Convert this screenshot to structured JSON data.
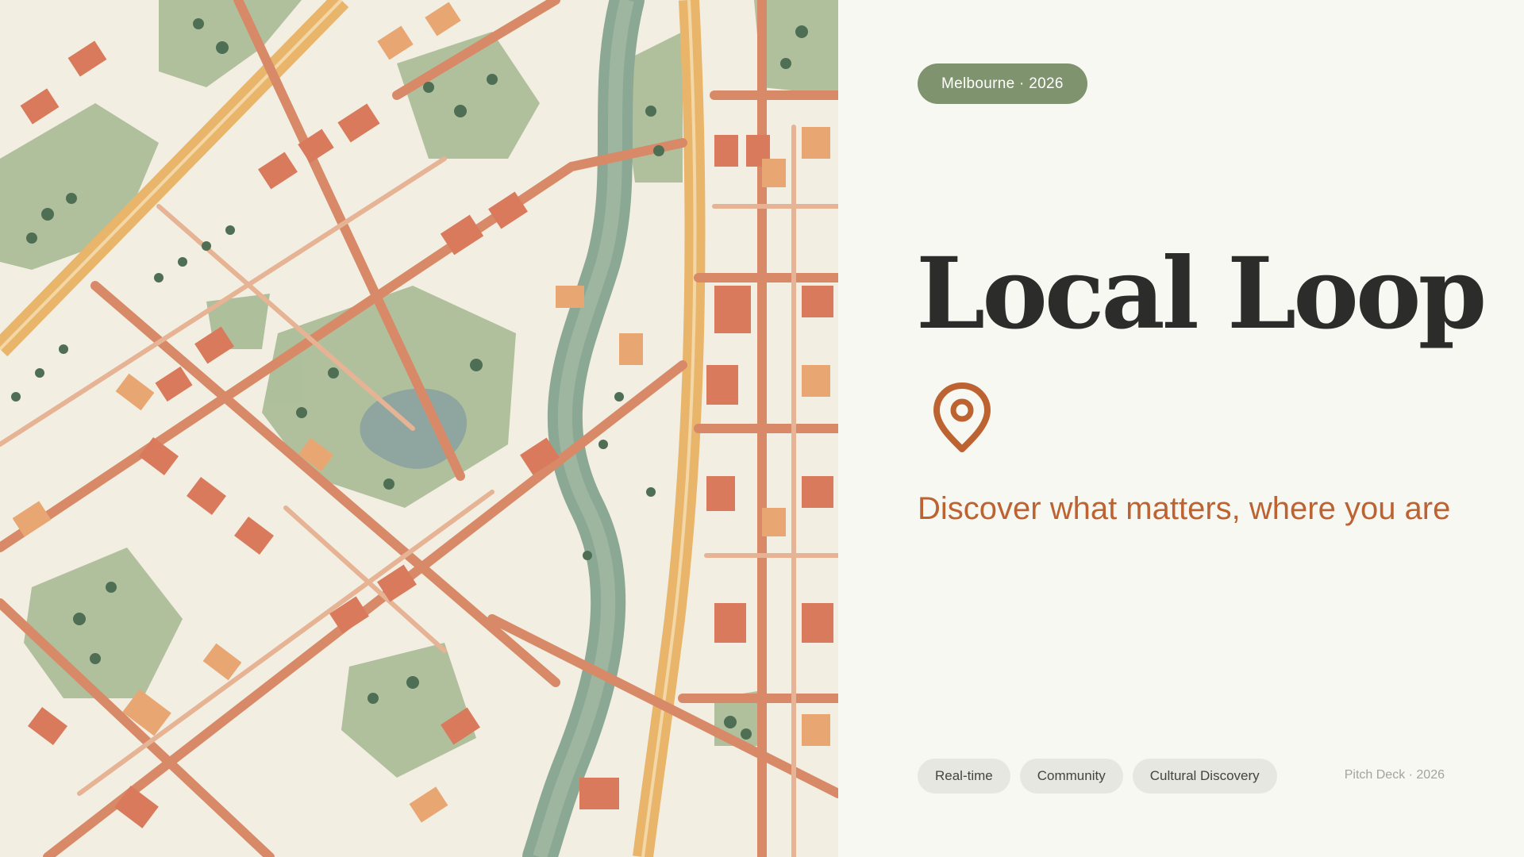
{
  "slide": {
    "location_badge": "Melbourne · 2026",
    "title": "Local Loop",
    "icon": "map-pin-icon",
    "tagline": "Discover what matters, where you are",
    "tags": [
      {
        "label": "Real-time"
      },
      {
        "label": "Community"
      },
      {
        "label": "Cultural Discovery"
      }
    ],
    "footer": "Pitch Deck · 2026"
  },
  "map_illustration": {
    "description_icon": "city-map-illustration"
  },
  "colors": {
    "background": "#f8f8f3",
    "accent": "#bd6332",
    "badge": "#7f936f",
    "title": "#2c2c2a",
    "tag_bg": "#e6e7e0",
    "map_park": "#9fb48c",
    "map_road": "#d88a68",
    "map_highway": "#e8b56a",
    "map_building": "#d97a5c",
    "map_river": "#8aa596"
  }
}
